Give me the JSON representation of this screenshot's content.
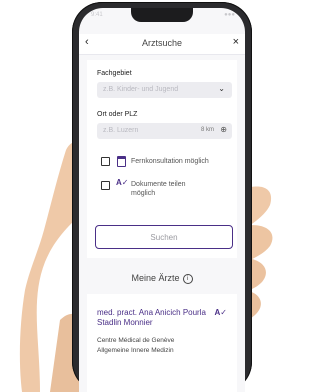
{
  "app": {
    "title": "Arztsuche",
    "back_icon": "chevron-left-icon",
    "close_icon": "close-icon",
    "status_left": "9:41",
    "status_right": "●●●"
  },
  "form": {
    "specialty_label": "Fachgebiet",
    "specialty_placeholder": "z.B. Kinder- und Jugend",
    "location_label": "Ort oder PLZ",
    "location_placeholder": "z.B. Luzern",
    "radius_value": "8 km",
    "option_teleconsult": "Fernkonsultation möglich",
    "option_documents": "Dokumente teilen möglich",
    "search_button": "Suchen"
  },
  "my_doctors": {
    "title": "Meine Ärzte",
    "card": {
      "name": "med. pract. Ana Anicich Pourla Stadlin Monnier",
      "org": "Centre Médical de Genève",
      "specialty": "Allgemeine Innere Medizin"
    }
  },
  "colors": {
    "accent": "#4a2f87",
    "field_bg": "#ececf0",
    "phone_frame": "#2b2b2e"
  }
}
